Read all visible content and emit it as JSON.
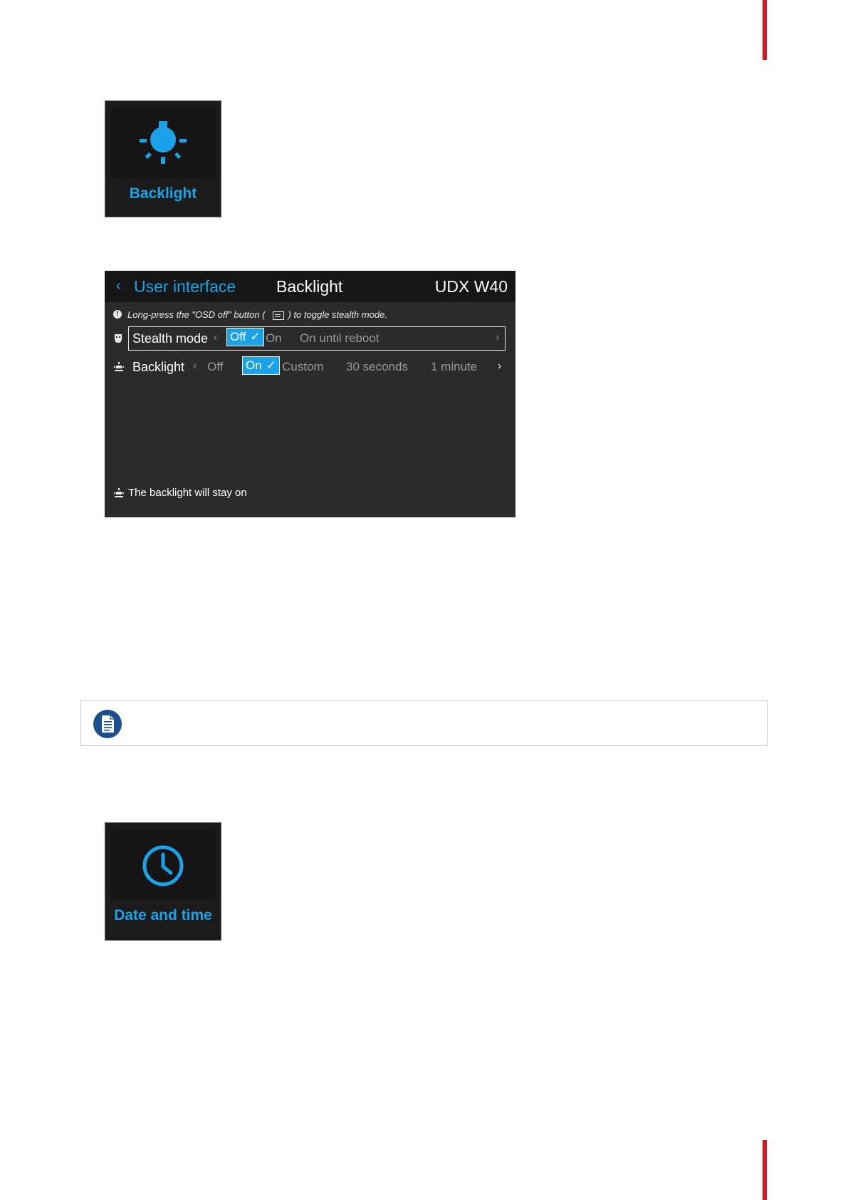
{
  "tiles": {
    "backlight": {
      "label": "Backlight",
      "icon": "lightbulb-icon"
    },
    "date_time": {
      "label": "Date and time",
      "icon": "clock-icon"
    }
  },
  "osd": {
    "back_icon": "chevron-left-icon",
    "breadcrumb": "User interface",
    "title": "Backlight",
    "model": "UDX W40",
    "info": {
      "icon": "info-icon",
      "text_before": "Long-press the \"OSD off\" button (",
      "button_icon": "osd-button-icon",
      "text_after": ") to toggle stealth mode."
    },
    "stealth_mode": {
      "icon": "mask-icon",
      "label": "Stealth mode",
      "options": [
        "Off",
        "On",
        "On until reboot"
      ],
      "selected": "Off"
    },
    "backlight": {
      "icon": "backlight-icon",
      "label": "Backlight",
      "options": [
        "Off",
        "On",
        "Custom",
        "30 seconds",
        "1 minute"
      ],
      "selected": "On"
    },
    "footer": {
      "icon": "backlight-icon",
      "text": "The backlight will stay on"
    }
  },
  "note": {
    "icon": "note-document-icon"
  },
  "colors": {
    "accent": "#1aa3e8",
    "osd_bg": "#2b2b2b",
    "header_bg": "#161616",
    "brand_red": "#d7191f",
    "note_icon": "#1c4f8f"
  }
}
